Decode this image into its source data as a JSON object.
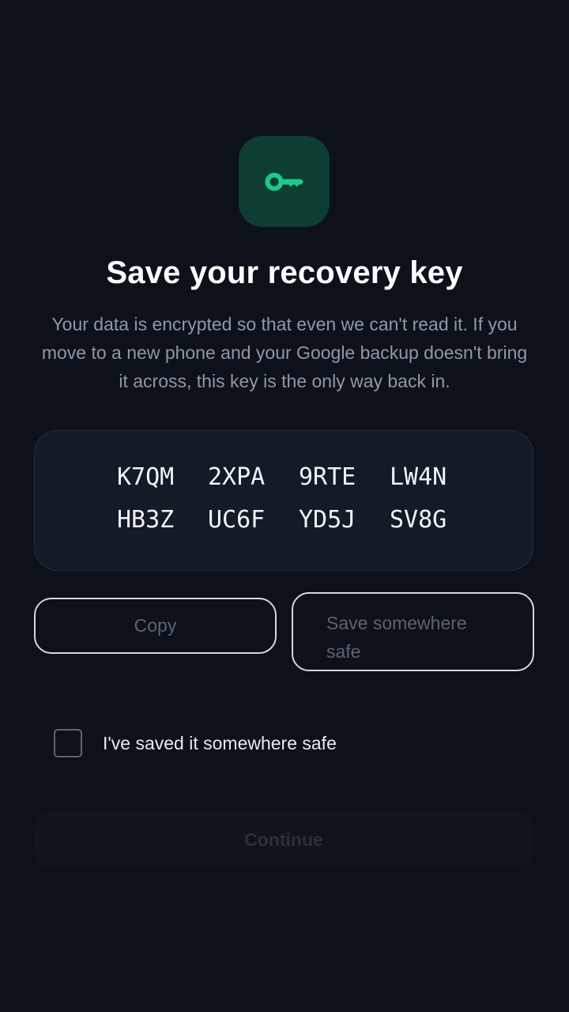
{
  "header": {
    "icon": "key-icon",
    "title": "Save your recovery key",
    "description": "Your data is encrypted so that even we can't read it. If you move to a new phone and your Google backup doesn't bring it across, this key is the only way back in."
  },
  "recovery_key": {
    "chunks": [
      "K7QM",
      "2XPA",
      "9RTE",
      "LW4N",
      "HB3Z",
      "UC6F",
      "YD5J",
      "SV8G"
    ]
  },
  "actions": {
    "copy_label": "Copy",
    "save_label": "Save somewhere safe"
  },
  "confirmation": {
    "label": "I've saved it somewhere safe",
    "checked": false
  },
  "continue": {
    "label": "Continue",
    "enabled": false
  },
  "colors": {
    "background": "#0c111a",
    "accent": "#1ec98a",
    "icon_tile": "#0d3d33",
    "card": "#131b27"
  }
}
